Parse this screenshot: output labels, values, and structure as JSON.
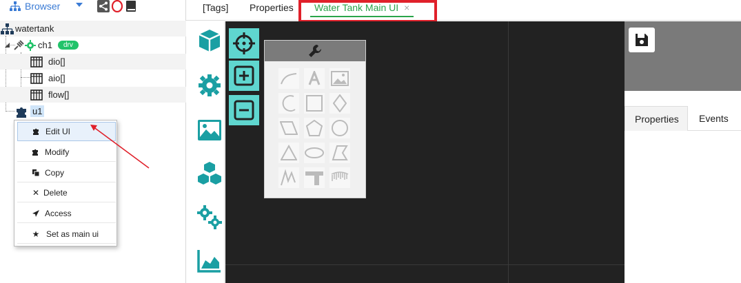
{
  "browser": {
    "label": "Browser"
  },
  "tree": {
    "root": "watertank",
    "driver": {
      "label": "ch1",
      "badge": "drv"
    },
    "tags": [
      "dio[]",
      "aio[]",
      "flow[]"
    ],
    "ui": "u1"
  },
  "context_menu": [
    {
      "label": "Edit UI",
      "icon": "puzzle-icon"
    },
    {
      "label": "Modify",
      "icon": "puzzle-icon"
    },
    {
      "label": "Copy",
      "icon": "copy-icon"
    },
    {
      "label": "Delete",
      "icon": "close-icon"
    },
    {
      "label": "Access",
      "icon": "send-icon"
    },
    {
      "label": "Set as main ui",
      "icon": "star-icon"
    }
  ],
  "tabs": [
    {
      "label": "[Tags]"
    },
    {
      "label": "Properties"
    },
    {
      "label": "Water Tank Main UI",
      "close": "×",
      "active": true
    }
  ],
  "properties_panel": {
    "tabs": [
      "Properties",
      "Events"
    ]
  },
  "colors": {
    "accent": "#5fd6cf",
    "teal": "#1a9fa3",
    "highlight": "#e0202a",
    "active_tab": "#2aa44a"
  }
}
